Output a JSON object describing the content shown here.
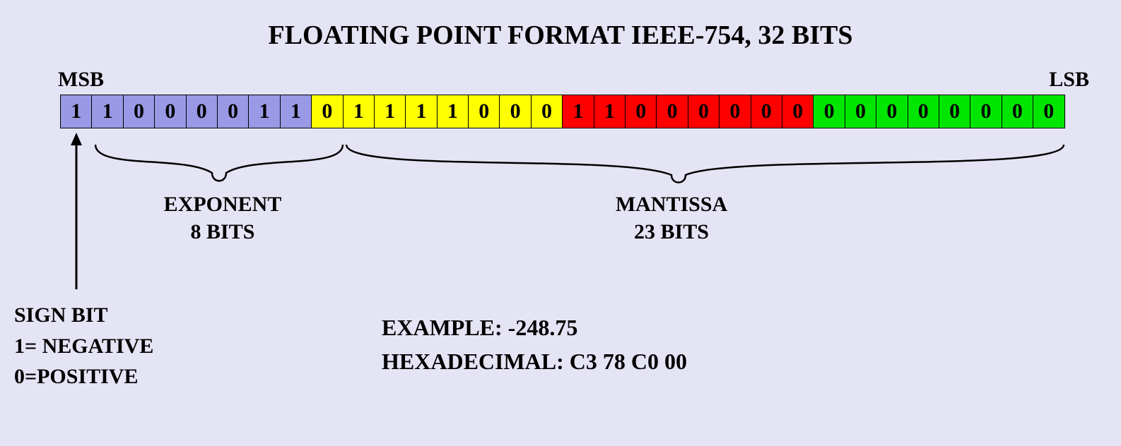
{
  "title": "FLOATING POINT FORMAT IEEE-754, 32 BITS",
  "labels": {
    "msb": "MSB",
    "lsb": "LSB",
    "exponent_line1": "EXPONENT",
    "exponent_line2": "8 BITS",
    "mantissa_line1": "MANTISSA",
    "mantissa_line2": "23 BITS",
    "sign_line1": "SIGN BIT",
    "sign_line2": "1= NEGATIVE",
    "sign_line3": "0=POSITIVE",
    "example_line1": "EXAMPLE: -248.75",
    "example_line2": "HEXADECIMAL: C3 78 C0 00"
  },
  "chart_data": {
    "type": "table",
    "description": "IEEE-754 single-precision 32-bit floating point layout",
    "bits": [
      {
        "index": 0,
        "value": 1,
        "group": 0,
        "section": "sign"
      },
      {
        "index": 1,
        "value": 1,
        "group": 0,
        "section": "exponent"
      },
      {
        "index": 2,
        "value": 0,
        "group": 0,
        "section": "exponent"
      },
      {
        "index": 3,
        "value": 0,
        "group": 0,
        "section": "exponent"
      },
      {
        "index": 4,
        "value": 0,
        "group": 0,
        "section": "exponent"
      },
      {
        "index": 5,
        "value": 0,
        "group": 0,
        "section": "exponent"
      },
      {
        "index": 6,
        "value": 1,
        "group": 0,
        "section": "exponent"
      },
      {
        "index": 7,
        "value": 1,
        "group": 0,
        "section": "exponent"
      },
      {
        "index": 8,
        "value": 0,
        "group": 1,
        "section": "exponent"
      },
      {
        "index": 9,
        "value": 1,
        "group": 1,
        "section": "mantissa"
      },
      {
        "index": 10,
        "value": 1,
        "group": 1,
        "section": "mantissa"
      },
      {
        "index": 11,
        "value": 1,
        "group": 1,
        "section": "mantissa"
      },
      {
        "index": 12,
        "value": 1,
        "group": 1,
        "section": "mantissa"
      },
      {
        "index": 13,
        "value": 0,
        "group": 1,
        "section": "mantissa"
      },
      {
        "index": 14,
        "value": 0,
        "group": 1,
        "section": "mantissa"
      },
      {
        "index": 15,
        "value": 0,
        "group": 1,
        "section": "mantissa"
      },
      {
        "index": 16,
        "value": 1,
        "group": 2,
        "section": "mantissa"
      },
      {
        "index": 17,
        "value": 1,
        "group": 2,
        "section": "mantissa"
      },
      {
        "index": 18,
        "value": 0,
        "group": 2,
        "section": "mantissa"
      },
      {
        "index": 19,
        "value": 0,
        "group": 2,
        "section": "mantissa"
      },
      {
        "index": 20,
        "value": 0,
        "group": 2,
        "section": "mantissa"
      },
      {
        "index": 21,
        "value": 0,
        "group": 2,
        "section": "mantissa"
      },
      {
        "index": 22,
        "value": 0,
        "group": 2,
        "section": "mantissa"
      },
      {
        "index": 23,
        "value": 0,
        "group": 2,
        "section": "mantissa"
      },
      {
        "index": 24,
        "value": 0,
        "group": 3,
        "section": "mantissa"
      },
      {
        "index": 25,
        "value": 0,
        "group": 3,
        "section": "mantissa"
      },
      {
        "index": 26,
        "value": 0,
        "group": 3,
        "section": "mantissa"
      },
      {
        "index": 27,
        "value": 0,
        "group": 3,
        "section": "mantissa"
      },
      {
        "index": 28,
        "value": 0,
        "group": 3,
        "section": "mantissa"
      },
      {
        "index": 29,
        "value": 0,
        "group": 3,
        "section": "mantissa"
      },
      {
        "index": 30,
        "value": 0,
        "group": 3,
        "section": "mantissa"
      },
      {
        "index": 31,
        "value": 0,
        "group": 3,
        "section": "mantissa"
      }
    ],
    "byte_colors": [
      "#9999e6",
      "#ffff00",
      "#ff0000",
      "#00e600"
    ],
    "field_widths": {
      "sign": 1,
      "exponent": 8,
      "mantissa": 23
    },
    "example_value": -248.75,
    "example_hex": "C3 78 C0 00"
  }
}
